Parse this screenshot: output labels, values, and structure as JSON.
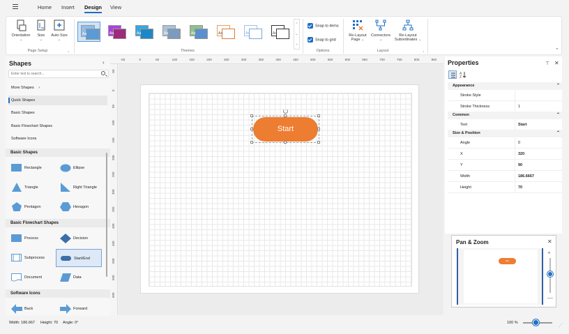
{
  "tabs": [
    "Home",
    "Insert",
    "Design",
    "View"
  ],
  "ribbon": {
    "page_setup": {
      "orientation": "Orientation",
      "size": "Size",
      "auto_size": "Auto Size",
      "label": "Page Setup"
    },
    "themes": {
      "sample": "Aa",
      "label": "Themes"
    },
    "options": {
      "snap_items": "Snap to items",
      "snap_grid": "Snap to grid",
      "label": "Options"
    },
    "layout": {
      "relayout_1": "Re-Layout",
      "relayout_2": "Page",
      "connectors": "Connectors",
      "subs_1": "Re-Layout",
      "subs_2": "Subordinates",
      "label": "Layout"
    }
  },
  "shapes_panel": {
    "title": "Shapes",
    "search_placeholder": "Enter text to search...",
    "categories": [
      "More Shapes",
      "Quick Shapes",
      "Basic Shapes",
      "Basic Flowchart Shapes",
      "Software Icons"
    ],
    "sections": {
      "basic": {
        "title": "Basic Shapes",
        "items": [
          "Rectangle",
          "Ellipse",
          "Triangle",
          "Right Triangle",
          "Pentagon",
          "Hexagon"
        ]
      },
      "flowchart": {
        "title": "Basic Flowchart Shapes",
        "items": [
          "Process",
          "Decision",
          "Subprocess",
          "Start/End",
          "Document",
          "Data"
        ]
      },
      "software": {
        "title": "Software Icons",
        "items": [
          "Back",
          "Forward"
        ]
      }
    }
  },
  "rulers": {
    "h": [
      "-50",
      "0",
      "50",
      "100",
      "150",
      "200",
      "250",
      "300",
      "350",
      "400",
      "450",
      "500",
      "550",
      "600",
      "650",
      "700",
      "750",
      "800",
      "850"
    ],
    "v": [
      "-50",
      "0",
      "50",
      "100",
      "150",
      "200",
      "250",
      "300",
      "350",
      "400",
      "450",
      "500",
      "550",
      "600"
    ]
  },
  "canvas": {
    "shape_text": "Start"
  },
  "properties": {
    "title": "Properties",
    "appearance": {
      "title": "Appearance",
      "rows": [
        {
          "name": "Stroke Style",
          "value": ""
        },
        {
          "name": "Stroke Thickness",
          "value": "1"
        }
      ]
    },
    "common": {
      "title": "Common",
      "rows": [
        {
          "name": "Text",
          "value": "Start"
        }
      ]
    },
    "size_position": {
      "title": "Size & Position",
      "rows": [
        {
          "name": "Angle",
          "value": "0"
        },
        {
          "name": "X",
          "value": "320"
        },
        {
          "name": "Y",
          "value": "90"
        },
        {
          "name": "Width",
          "value": "186.6667"
        },
        {
          "name": "Height",
          "value": "70"
        }
      ]
    }
  },
  "pan_zoom": {
    "title": "Pan & Zoom",
    "preview_text": "Start",
    "zoom_level": 0.55
  },
  "status": {
    "width": "Width: 186.667",
    "height": "Height: 70",
    "angle": "Angle: 0°",
    "zoom": "100 %"
  },
  "colors": {
    "accent": "#1d6fc5",
    "shape_fill": "#ed7d31",
    "selection": "#5b9bd5"
  }
}
